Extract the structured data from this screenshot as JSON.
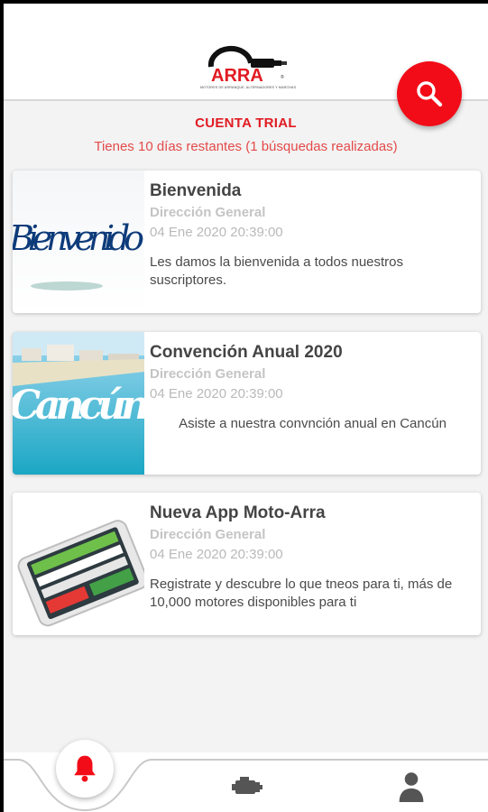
{
  "header": {
    "logo_text": "ARRA",
    "logo_subtitle": "MOTORES DE ARRANQUE, ALTERNADORES Y MARCHAS"
  },
  "trial": {
    "title": "CUENTA TRIAL",
    "subtitle": "Tienes 10 días restantes (1 búsquedas realizadas)"
  },
  "news": [
    {
      "title": "Bienvenida",
      "author": "Dirección General",
      "date": "04 Ene 2020 20:39:00",
      "description": "Les damos la bienvenida a todos nuestros suscriptores.",
      "image_text": "Bienvenido"
    },
    {
      "title": "Convención Anual 2020",
      "author": "Dirección General",
      "date": "04 Ene 2020 20:39:00",
      "description": "Asiste a nuestra convnción anual en Cancún",
      "image_text": "Cancún"
    },
    {
      "title": "Nueva App Moto-Arra",
      "author": "Dirección General",
      "date": "04 Ene 2020 20:39:00",
      "description": "Registrate y descubre lo que tneos para ti, más de 10,000 motores disponibles para ti"
    }
  ],
  "tabs": [
    {
      "icon": "bell-icon",
      "active": true
    },
    {
      "icon": "engine-icon",
      "active": false
    },
    {
      "icon": "user-icon",
      "active": false
    }
  ],
  "colors": {
    "accent": "#f20c17",
    "trial_text": "#e11b22",
    "icon_gray": "#555555"
  }
}
